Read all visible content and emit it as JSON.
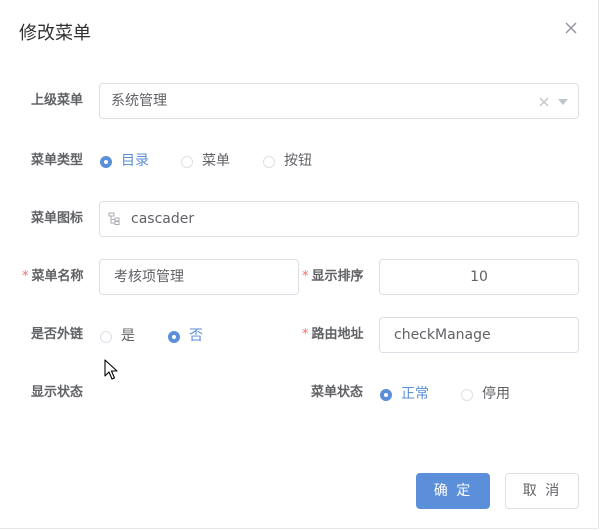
{
  "dialog": {
    "title": "修改菜单",
    "close_icon": "close-icon"
  },
  "form": {
    "parent_menu": {
      "label": "上级菜单",
      "value": "系统管理"
    },
    "menu_type": {
      "label": "菜单类型",
      "options": [
        "目录",
        "菜单",
        "按钮"
      ],
      "selected": "目录"
    },
    "menu_icon": {
      "label": "菜单图标",
      "value": "cascader",
      "icon": "tree-icon"
    },
    "menu_name": {
      "label": "菜单名称",
      "value": "考核项管理",
      "required": "*"
    },
    "sort_order": {
      "label": "显示排序",
      "value": "10",
      "required": "*"
    },
    "is_external": {
      "label": "是否外链",
      "options": [
        "是",
        "否"
      ],
      "selected": "否"
    },
    "route_path": {
      "label": "路由地址",
      "value": "checkManage",
      "required": "*"
    },
    "display_status": {
      "label": "显示状态"
    },
    "menu_status": {
      "label": "菜单状态",
      "options": [
        "正常",
        "停用"
      ],
      "selected": "正常"
    }
  },
  "footer": {
    "confirm_label": "确 定",
    "cancel_label": "取 消"
  },
  "colors": {
    "primary": "#5b8fd9",
    "required": "#f56c6c",
    "border": "#dcdfe6"
  }
}
